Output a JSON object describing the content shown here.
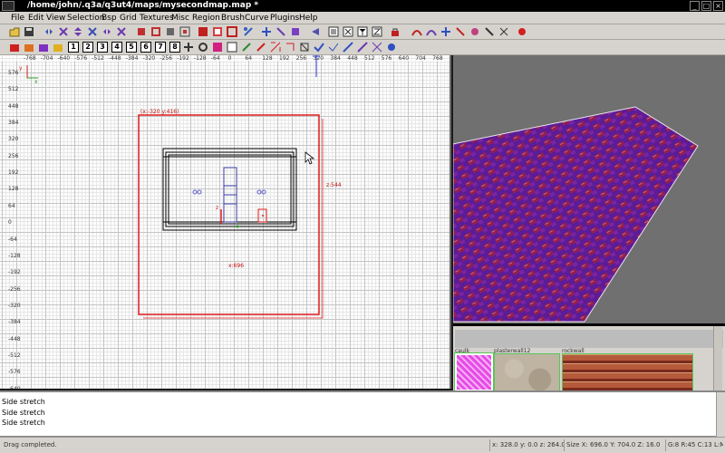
{
  "window": {
    "title": "/home/john/.q3a/q3ut4/maps/mysecondmap.map *"
  },
  "menu": [
    "File",
    "Edit",
    "View",
    "Selection",
    "Bsp",
    "Grid",
    "Textures",
    "Misc",
    "Region",
    "Brush",
    "Curve",
    "Plugins",
    "Help"
  ],
  "toolbar": {
    "grid_size_buttons": [
      "1",
      "2",
      "3",
      "4",
      "5",
      "6",
      "7",
      "8"
    ]
  },
  "grid_view": {
    "ruler_x": [
      "-768",
      "-704",
      "-640",
      "-576",
      "-512",
      "-448",
      "-384",
      "-320",
      "-256",
      "-192",
      "-128",
      "-64",
      "0",
      "64",
      "128",
      "192",
      "256",
      "320",
      "384",
      "448",
      "512",
      "576",
      "640",
      "704",
      "768",
      "832"
    ],
    "ruler_y": [
      "576",
      "512",
      "448",
      "384",
      "320",
      "256",
      "192",
      "128",
      "64",
      "0",
      "-64",
      "-128",
      "-192",
      "-256",
      "-320",
      "-384",
      "-448",
      "-512",
      "-576",
      "-640"
    ],
    "axis_x_label": "x",
    "axis_y_label": "y",
    "selection_origin": "(x:-320  y:416)",
    "selection_width": "x:696",
    "selection_height": "z:544",
    "entity_z_label": "z"
  },
  "texture_browser": {
    "textures": [
      {
        "name": "caulk"
      },
      {
        "name": "plasterwall12"
      },
      {
        "name": "rockwall"
      }
    ]
  },
  "console": {
    "lines": [
      "Side stretch",
      "Side stretch",
      "Side stretch"
    ]
  },
  "statusbar": {
    "message": "Drag completed.",
    "coords": "x:  328.0   y:  0.0   z:  264.0",
    "size": "Size X:  696.0  Y:  704.0  Z:  16.0",
    "grid": "G:8 R:45 C:13 L:MR"
  },
  "colors": {
    "selection_red": "#e21a1a",
    "texture_purple": "#6a2aa8",
    "texture_red": "#b82336",
    "caulk_pink": "#e64ce6"
  }
}
